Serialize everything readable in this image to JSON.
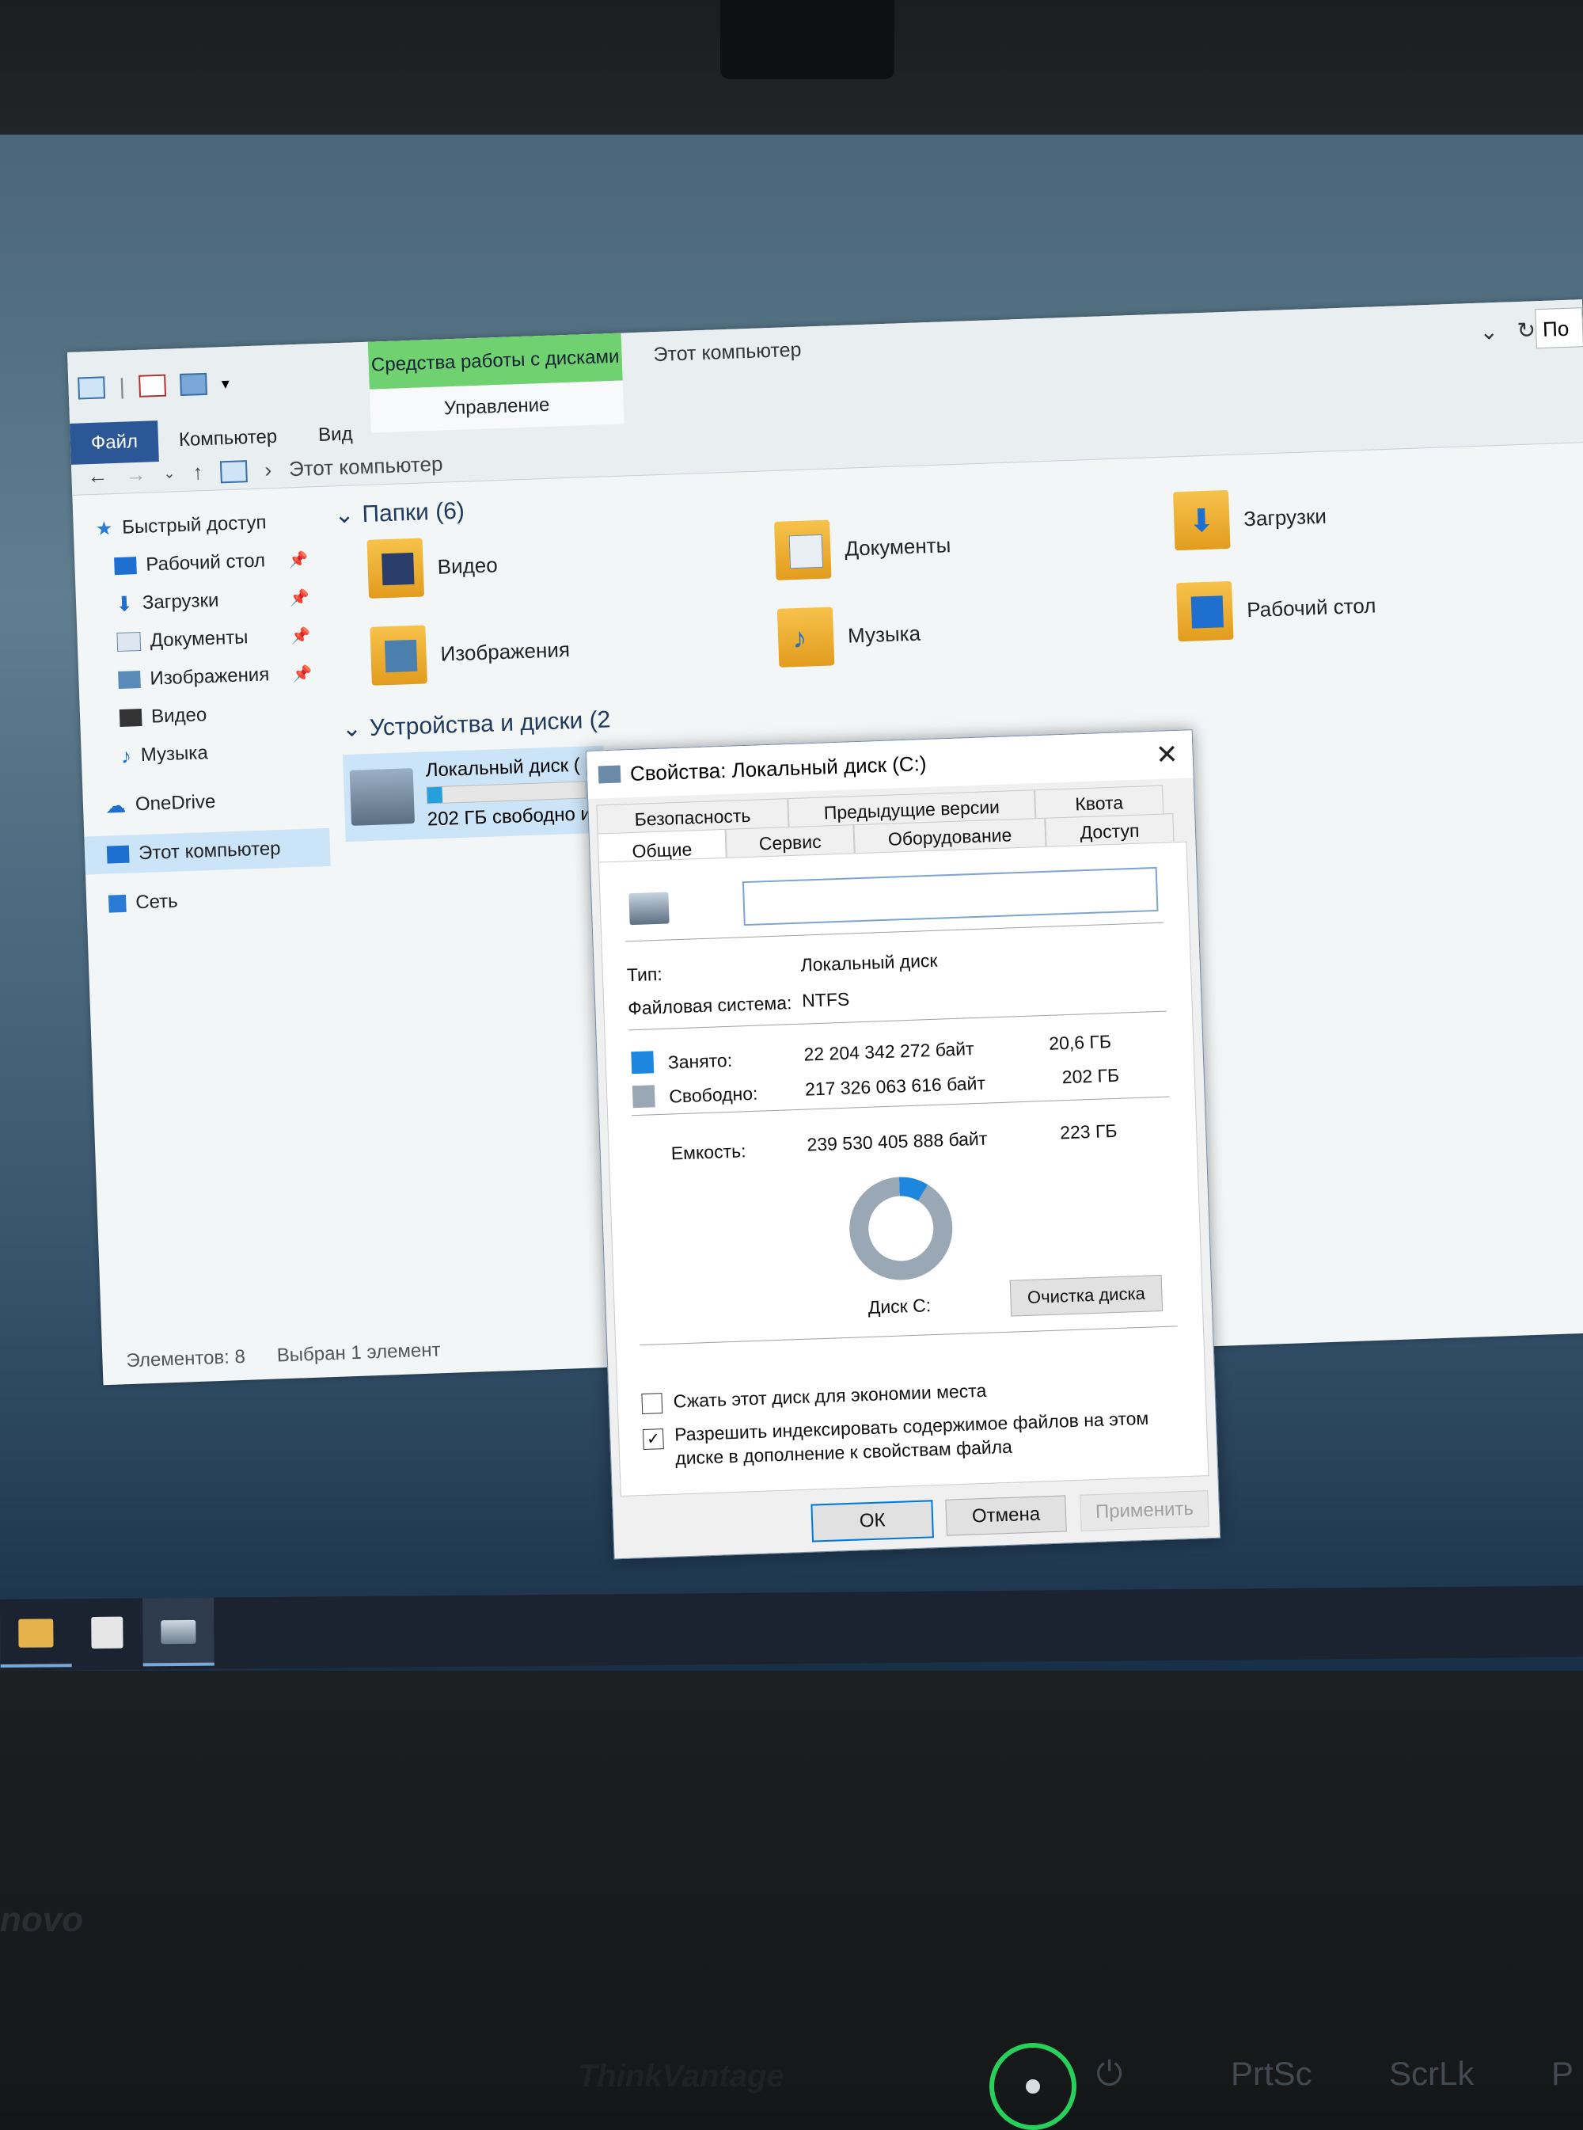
{
  "explorer": {
    "window_title": "Этот компьютер",
    "tools_tab": "Средства работы с дисками",
    "tools_sub": "Управление",
    "menu": [
      "Файл",
      "Компьютер",
      "Вид"
    ],
    "address": "Этот компьютер",
    "address_right": "По",
    "sidebar": [
      {
        "label": "Быстрый доступ",
        "icon": "star-icon",
        "pinned": false
      },
      {
        "label": "Рабочий стол",
        "icon": "desktop-icon",
        "pinned": true
      },
      {
        "label": "Загрузки",
        "icon": "download-icon",
        "pinned": true
      },
      {
        "label": "Документы",
        "icon": "documents-icon",
        "pinned": true
      },
      {
        "label": "Изображения",
        "icon": "pictures-icon",
        "pinned": true
      },
      {
        "label": "Видео",
        "icon": "video-icon",
        "pinned": false
      },
      {
        "label": "Музыка",
        "icon": "music-icon",
        "pinned": false
      },
      {
        "label": "OneDrive",
        "icon": "cloud-icon",
        "pinned": false
      },
      {
        "label": "Этот компьютер",
        "icon": "computer-icon",
        "pinned": false,
        "selected": true
      },
      {
        "label": "Сеть",
        "icon": "network-icon",
        "pinned": false
      }
    ],
    "folders_header": "Папки (6)",
    "folders": [
      "Видео",
      "Документы",
      "Загрузки",
      "Изображения",
      "Музыка",
      "Рабочий стол"
    ],
    "devices_header": "Устройства и диски (2",
    "drive_name": "Локальный диск (",
    "drive_free": "202 ГБ свободно и",
    "drive_used_fraction": 0.093,
    "status_items": "Элементов: 8",
    "status_selected": "Выбран 1 элемент"
  },
  "dialog": {
    "title": "Свойства: Локальный диск (C:)",
    "tabs_back": [
      "Безопасность",
      "Предыдущие версии",
      "Квота"
    ],
    "tabs_front": [
      "Общие",
      "Сервис",
      "Оборудование",
      "Доступ"
    ],
    "active_tab": "Общие",
    "name_value": "",
    "type_label": "Тип:",
    "type_value": "Локальный диск",
    "fs_label": "Файловая система:",
    "fs_value": "NTFS",
    "used_label": "Занято:",
    "used_bytes": "22 204 342 272 байт",
    "used_gb": "20,6 ГБ",
    "free_label": "Свободно:",
    "free_bytes": "217 326 063 616 байт",
    "free_gb": "202 ГБ",
    "cap_label": "Емкость:",
    "cap_bytes": "239 530 405 888 байт",
    "cap_gb": "223 ГБ",
    "used_fraction": 0.093,
    "disk_label": "Диск C:",
    "cleanup_button": "Очистка диска",
    "compress_label": "Сжать этот диск для экономии места",
    "compress_checked": false,
    "index_label_1": "Разрешить индексировать содержимое файлов на этом",
    "index_label_2": "диске в дополнение к свойствам файла",
    "index_checked": true,
    "ok": "ОК",
    "cancel": "Отмена",
    "apply": "Применить",
    "colors": {
      "used": "#1d87e0",
      "free": "#9aa7b5"
    }
  },
  "laptop": {
    "brand": "novo",
    "think": "ThinkVantage",
    "keys": [
      "PrtSc",
      "ScrLk",
      "P"
    ]
  }
}
